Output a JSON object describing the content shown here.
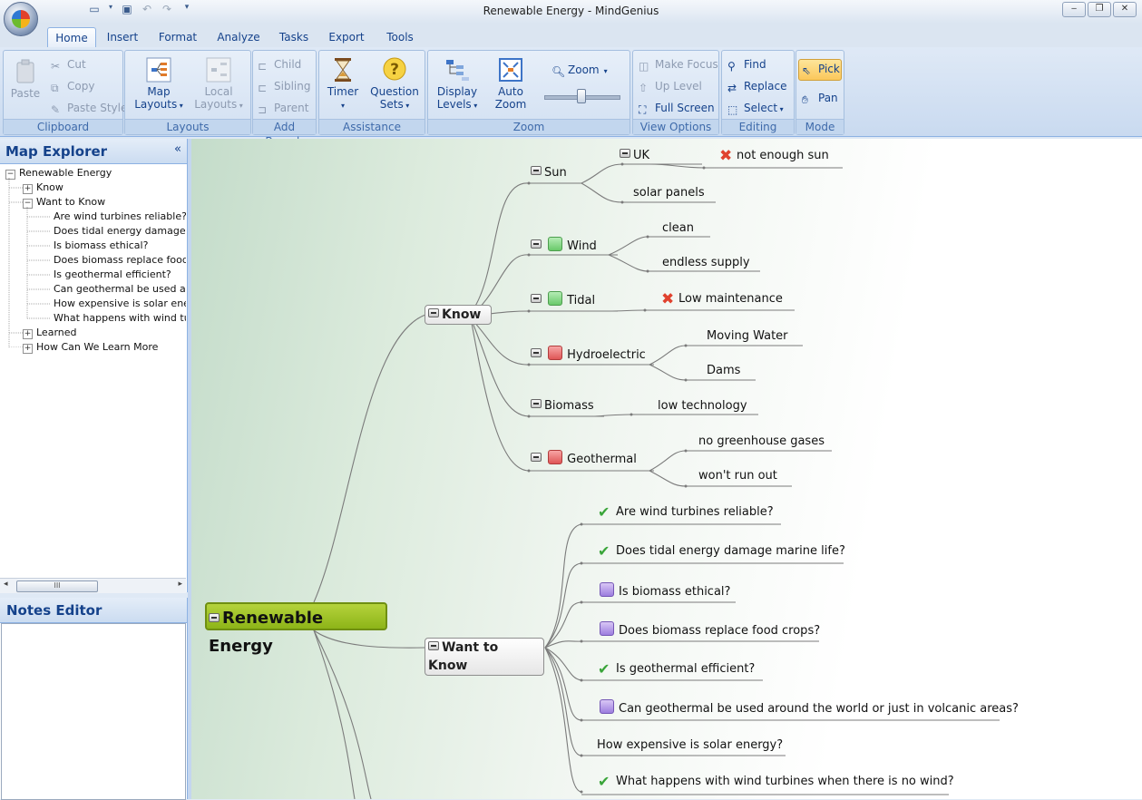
{
  "window": {
    "title": "Renewable Energy - MindGenius"
  },
  "qat": {
    "new_icon": "new-document-icon",
    "save_icon": "save-icon",
    "undo_icon": "undo-icon",
    "redo_icon": "redo-icon",
    "customize_icon": "customize-toolbar-icon"
  },
  "tabs": [
    "Home",
    "Insert",
    "Format",
    "Analyze",
    "Tasks",
    "Export",
    "Tools"
  ],
  "ribbon": {
    "clipboard": {
      "label": "Clipboard",
      "paste": "Paste",
      "cut": "Cut",
      "copy": "Copy",
      "paste_style": "Paste Style"
    },
    "layouts": {
      "label": "Layouts",
      "map_layouts_1": "Map",
      "map_layouts_2": "Layouts",
      "local_layouts_1": "Local",
      "local_layouts_2": "Layouts"
    },
    "add_branch": {
      "label": "Add Branch",
      "child": "Child",
      "sibling": "Sibling",
      "parent": "Parent"
    },
    "assistance": {
      "label": "Assistance",
      "timer": "Timer",
      "question_1": "Question",
      "question_2": "Sets"
    },
    "zoom": {
      "label": "Zoom",
      "display_1": "Display",
      "display_2": "Levels",
      "auto_1": "Auto",
      "auto_2": "Zoom",
      "zoom": "Zoom"
    },
    "view_options": {
      "label": "View Options",
      "make_focus": "Make Focus",
      "up_level": "Up Level",
      "full_screen": "Full Screen"
    },
    "editing": {
      "label": "Editing",
      "find": "Find",
      "replace": "Replace",
      "select": "Select"
    },
    "mode": {
      "label": "Mode",
      "pick": "Pick",
      "pan": "Pan"
    }
  },
  "explorer": {
    "title": "Map Explorer",
    "collapse": "«",
    "items": [
      {
        "text": "Renewable Energy",
        "toggle": "−"
      },
      {
        "text": "Know",
        "toggle": "+"
      },
      {
        "text": "Want to Know",
        "toggle": "−"
      },
      {
        "text": "Are wind turbines reliable?"
      },
      {
        "text": "Does tidal energy damage marine life?"
      },
      {
        "text": "Is biomass ethical?"
      },
      {
        "text": "Does biomass replace food crops?"
      },
      {
        "text": "Is geothermal efficient?"
      },
      {
        "text": "Can geothermal be used around the world or just in volcanic areas?"
      },
      {
        "text": "How expensive is solar energy?"
      },
      {
        "text": "What happens with wind turbines when there is no wind?"
      },
      {
        "text": "Learned",
        "toggle": "+"
      },
      {
        "text": "How Can We Learn More",
        "toggle": "+"
      }
    ],
    "scroll_thumb": "III"
  },
  "notes": {
    "title": "Notes Editor"
  },
  "map": {
    "central": "Renewable Energy",
    "know": "Know",
    "want": "Want to Know",
    "sun": "Sun",
    "uk": "UK",
    "not_enough_sun": "not enough sun",
    "solar_panels": "solar panels",
    "wind": "Wind",
    "clean": "clean",
    "endless_supply": "endless supply",
    "tidal": "Tidal",
    "low_maintenance": "Low maintenance",
    "hydro": "Hydroelectric",
    "moving_water": "Moving Water",
    "dams": "Dams",
    "biomass": "Biomass",
    "low_technology": "low technology",
    "geothermal": "Geothermal",
    "no_greenhouse": "no greenhouse gases",
    "wont_run_out": "won't run out",
    "q1": "Are wind turbines reliable?",
    "q2": "Does tidal energy damage marine life?",
    "q3": "Is biomass ethical?",
    "q4": "Does biomass replace food crops?",
    "q5": "Is geothermal efficient?",
    "q6": "Can geothermal be used around the world or just in volcanic areas?",
    "q7": "How expensive is solar energy?",
    "q8": "What happens with wind turbines when there is no wind?"
  },
  "colors": {
    "central_fill": "#a2c42a",
    "ribbon_text": "#15428b",
    "pick_highlight": "#fbc75b",
    "status_green": "#69c96a",
    "status_red": "#df5656",
    "question_purple": "#9c7ddf"
  }
}
